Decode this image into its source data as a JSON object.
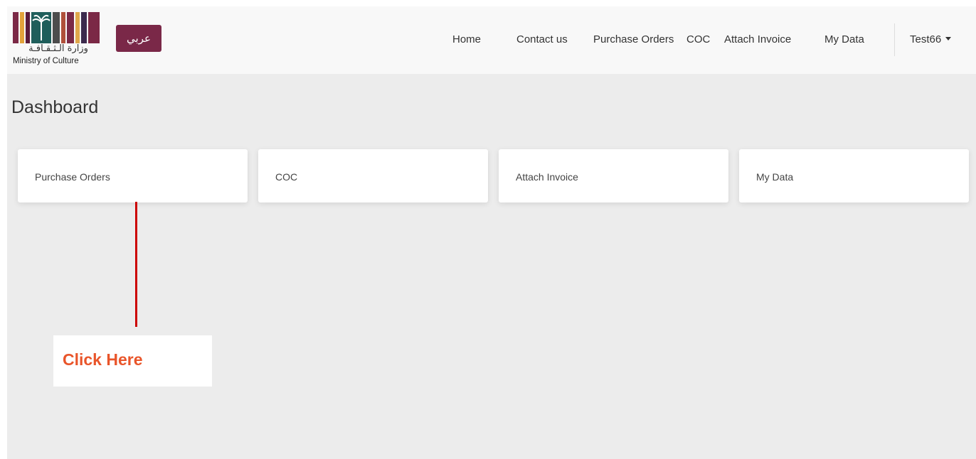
{
  "logo": {
    "arabic": "وزارة الـثـقـافـة",
    "english": "Ministry of Culture",
    "bar_colors": [
      "#7b2946",
      "#e2a23a",
      "#5a1a3a",
      "#1f5e5b",
      "#4d4d4d",
      "#b0503a",
      "#7b2946",
      "#e0a74a",
      "#3c2a4d",
      "#7b2946"
    ]
  },
  "language_button": {
    "label": "عربي",
    "color": "#7a2848"
  },
  "nav": {
    "items": [
      {
        "id": "home",
        "label": "Home"
      },
      {
        "id": "contact",
        "label": "Contact us"
      },
      {
        "id": "purchase-orders",
        "label": "Purchase Orders"
      },
      {
        "id": "coc",
        "label": "COC"
      },
      {
        "id": "attach-invoice",
        "label": "Attach Invoice"
      },
      {
        "id": "my-data",
        "label": "My Data"
      }
    ],
    "user": "Test66"
  },
  "dashboard": {
    "title": "Dashboard",
    "cards": [
      {
        "label": "Purchase Orders"
      },
      {
        "label": "COC"
      },
      {
        "label": "Attach Invoice"
      },
      {
        "label": "My Data"
      }
    ]
  },
  "annotation": {
    "text": "Click Here",
    "text_color": "#e9552a",
    "line_color": "#cc0000"
  }
}
